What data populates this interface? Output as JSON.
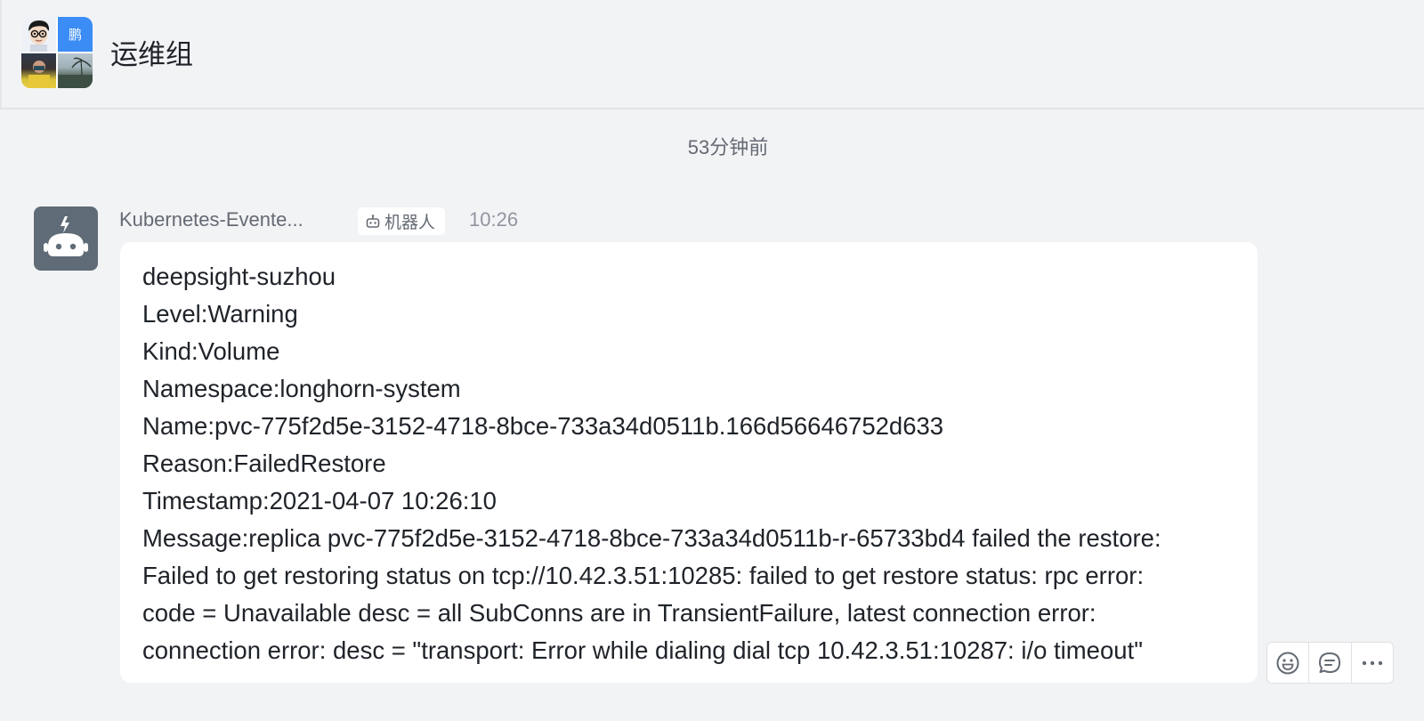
{
  "header": {
    "group_name": "运维组",
    "avatar_text": "鹏"
  },
  "divider": {
    "relative_time": "53分钟前"
  },
  "message": {
    "sender": "Kubernetes-Evente...",
    "bot_tag": "机器人",
    "time": "10:26",
    "lines": [
      "deepsight-suzhou",
      "Level:Warning",
      "Kind:Volume",
      "Namespace:longhorn-system",
      "Name:pvc-775f2d5e-3152-4718-8bce-733a34d0511b.166d56646752d633",
      "Reason:FailedRestore",
      "Timestamp:2021-04-07 10:26:10",
      "Message:replica pvc-775f2d5e-3152-4718-8bce-733a34d0511b-r-65733bd4 failed the restore:",
      "Failed to get restoring status on tcp://10.42.3.51:10285: failed to get restore status: rpc error:",
      "code = Unavailable desc = all SubConns are in TransientFailure, latest connection error:",
      "connection error: desc = \"transport: Error while dialing dial tcp 10.42.3.51:10287: i/o timeout\""
    ]
  },
  "actions": {
    "icons": [
      "emoji-reaction-icon",
      "reply-icon",
      "more-icon"
    ]
  },
  "colors": {
    "background": "#f2f3f5",
    "bubble": "#ffffff",
    "bot_avatar": "#5f6b77",
    "avatar_accent": "#3b8cf5"
  }
}
